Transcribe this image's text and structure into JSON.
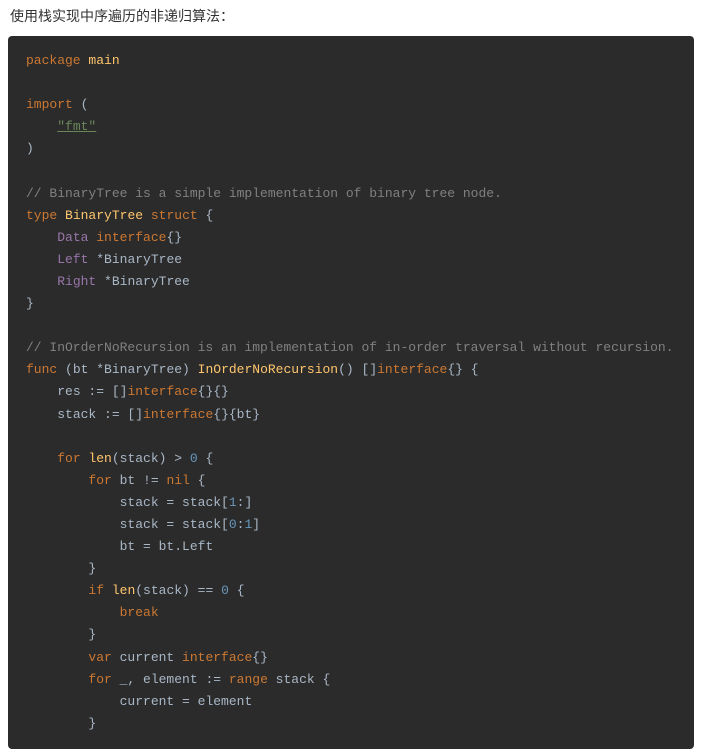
{
  "heading": "使用栈实现中序遍历的非递归算法：",
  "code": {
    "line1_package": "package",
    "line1_main": "main",
    "line3_import": "import",
    "line3_paren": " (",
    "line4_str": "\"fmt\"",
    "line5_paren": ")",
    "line7_comment": "// BinaryTree is a simple implementation of binary tree node.",
    "line8_type": "type",
    "line8_name": "BinaryTree",
    "line8_struct": "struct",
    "line8_brace": " {",
    "line9_field": "Data",
    "line9_ifc": "interface",
    "line9_end": "{}",
    "line10_field": "Left",
    "line10_type": "*BinaryTree",
    "line11_field": "Right",
    "line11_type": "*BinaryTree",
    "line12_brace": "}",
    "line14_comment": "// InOrderNoRecursion is an implementation of in-order traversal without recursion.",
    "line15_func": "func",
    "line15_recv": "(bt *BinaryTree)",
    "line15_name": "InOrderNoRecursion",
    "line15_params": "() []",
    "line15_ifc": "interface",
    "line15_end": "{} {",
    "line16_res": "res := []",
    "line16_ifc": "interface",
    "line16_end": "{}{}",
    "line17_stack": "stack := []",
    "line17_ifc": "interface",
    "line17_end": "{}{bt}",
    "line19_for": "for",
    "line19_len": "len",
    "line19_cond": "(stack) > ",
    "line19_zero": "0",
    "line19_brace": " {",
    "line20_for": "for",
    "line20_cond": " bt != ",
    "line20_nil": "nil",
    "line20_brace": " {",
    "line21": "stack = stack[",
    "line21_one": "1",
    "line21_end": ":]",
    "line22": "stack = stack[",
    "line22_zero": "0",
    "line22_colon": ":",
    "line22_one": "1",
    "line22_end": "]",
    "line23": "bt = bt.Left",
    "line24_brace": "}",
    "line25_if": "if",
    "line25_len": "len",
    "line25_cond": "(stack) == ",
    "line25_zero": "0",
    "line25_brace": " {",
    "line26_break": "break",
    "line27_brace": "}",
    "line28_var": "var",
    "line28_rest": " current ",
    "line28_ifc": "interface",
    "line28_end": "{}",
    "line29_for": "for",
    "line29_rest": " _, element := ",
    "line29_range": "range",
    "line29_end": " stack {",
    "line30": "current = element",
    "line31_brace": "}"
  }
}
